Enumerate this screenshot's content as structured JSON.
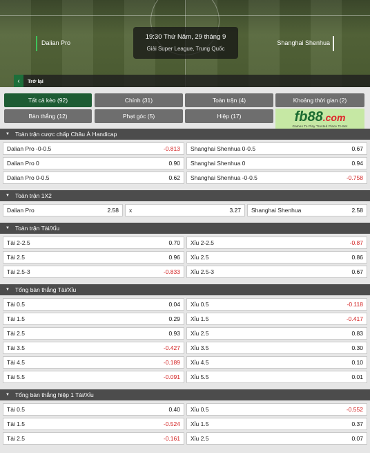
{
  "match": {
    "home": "Dalian Pro",
    "away": "Shanghai Shenhua",
    "datetime": "19:30 Thứ Năm, 29 tháng 9",
    "league": "Giải Super League, Trung Quốc",
    "back_label": "Trở lại"
  },
  "tabs": [
    {
      "label": "Tất cả kèo (92)",
      "active": true
    },
    {
      "label": "Chính (31)",
      "active": false
    },
    {
      "label": "Toàn trận (4)",
      "active": false
    },
    {
      "label": "Khoảng thời gian (2)",
      "active": false
    },
    {
      "label": "Bàn thắng (12)",
      "active": false
    },
    {
      "label": "Phạt góc (5)",
      "active": false
    },
    {
      "label": "Hiệp (17)",
      "active": false
    }
  ],
  "brand": {
    "logo_main": "fb88",
    "logo_suffix": ".com",
    "tagline": "Games To Play Trusted Place To Bet"
  },
  "sections": [
    {
      "title": "Toàn trận cược chấp Châu Á Handicap",
      "columns": 2,
      "rows": [
        [
          {
            "label": "Dalian Pro -0-0.5",
            "value": "-0.813",
            "neg": true
          },
          {
            "label": "Shanghai Shenhua 0-0.5",
            "value": "0.67",
            "neg": false
          }
        ],
        [
          {
            "label": "Dalian Pro 0",
            "value": "0.90",
            "neg": false
          },
          {
            "label": "Shanghai Shenhua 0",
            "value": "0.94",
            "neg": false
          }
        ],
        [
          {
            "label": "Dalian Pro 0-0.5",
            "value": "0.62",
            "neg": false
          },
          {
            "label": "Shanghai Shenhua -0-0.5",
            "value": "-0.758",
            "neg": true
          }
        ]
      ]
    },
    {
      "title": "Toàn trận 1X2",
      "columns": 3,
      "rows": [
        [
          {
            "label": "Dalian Pro",
            "value": "2.58",
            "neg": false
          },
          {
            "label": "x",
            "value": "3.27",
            "neg": false
          },
          {
            "label": "Shanghai Shenhua",
            "value": "2.58",
            "neg": false
          }
        ]
      ]
    },
    {
      "title": "Toàn trận Tài/Xỉu",
      "columns": 2,
      "rows": [
        [
          {
            "label": "Tài 2-2.5",
            "value": "0.70",
            "neg": false
          },
          {
            "label": "Xỉu 2-2.5",
            "value": "-0.87",
            "neg": true
          }
        ],
        [
          {
            "label": "Tài 2.5",
            "value": "0.96",
            "neg": false
          },
          {
            "label": "Xỉu 2.5",
            "value": "0.86",
            "neg": false
          }
        ],
        [
          {
            "label": "Tài 2.5-3",
            "value": "-0.833",
            "neg": true
          },
          {
            "label": "Xỉu 2.5-3",
            "value": "0.67",
            "neg": false
          }
        ]
      ]
    },
    {
      "title": "Tổng bàn thắng Tài/Xỉu",
      "columns": 2,
      "rows": [
        [
          {
            "label": "Tài 0.5",
            "value": "0.04",
            "neg": false
          },
          {
            "label": "Xỉu 0.5",
            "value": "-0.118",
            "neg": true
          }
        ],
        [
          {
            "label": "Tài 1.5",
            "value": "0.29",
            "neg": false
          },
          {
            "label": "Xỉu 1.5",
            "value": "-0.417",
            "neg": true
          }
        ],
        [
          {
            "label": "Tài 2.5",
            "value": "0.93",
            "neg": false
          },
          {
            "label": "Xỉu 2.5",
            "value": "0.83",
            "neg": false
          }
        ],
        [
          {
            "label": "Tài 3.5",
            "value": "-0.427",
            "neg": true
          },
          {
            "label": "Xỉu 3.5",
            "value": "0.30",
            "neg": false
          }
        ],
        [
          {
            "label": "Tài 4.5",
            "value": "-0.189",
            "neg": true
          },
          {
            "label": "Xỉu 4.5",
            "value": "0.10",
            "neg": false
          }
        ],
        [
          {
            "label": "Tài 5.5",
            "value": "-0.091",
            "neg": true
          },
          {
            "label": "Xỉu 5.5",
            "value": "0.01",
            "neg": false
          }
        ]
      ]
    },
    {
      "title": "Tổng bàn thắng hiệp 1 Tài/Xỉu",
      "columns": 2,
      "rows": [
        [
          {
            "label": "Tài 0.5",
            "value": "0.40",
            "neg": false
          },
          {
            "label": "Xỉu 0.5",
            "value": "-0.552",
            "neg": true
          }
        ],
        [
          {
            "label": "Tài 1.5",
            "value": "-0.524",
            "neg": true
          },
          {
            "label": "Xỉu 1.5",
            "value": "0.37",
            "neg": false
          }
        ],
        [
          {
            "label": "Tài 2.5",
            "value": "-0.161",
            "neg": true
          },
          {
            "label": "Xỉu 2.5",
            "value": "0.07",
            "neg": false
          }
        ]
      ]
    }
  ]
}
